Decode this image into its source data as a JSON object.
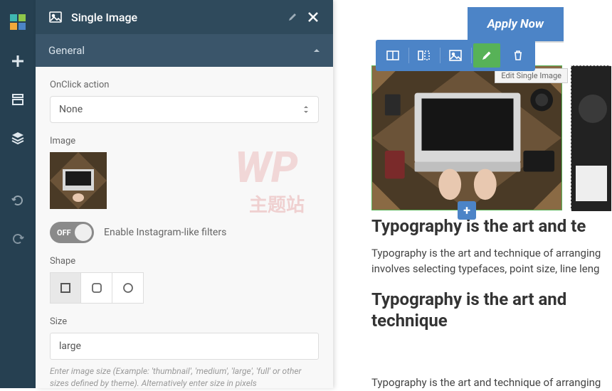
{
  "panel": {
    "title": "Single Image",
    "section": "General",
    "onclick_label": "OnClick action",
    "onclick_value": "None",
    "image_label": "Image",
    "filters_toggle_off": "OFF",
    "filters_label": "Enable Instagram-like filters",
    "shape_label": "Shape",
    "size_label": "Size",
    "size_value": "large",
    "size_help": "Enter image size (Example: 'thumbnail', 'medium', 'large', 'full' or other sizes defined by theme). Alternatively enter size in pixels"
  },
  "toolbar": {
    "tooltip": "Edit Single Image"
  },
  "content": {
    "apply": "Apply Now",
    "heading1": "Typography is the art and te",
    "para1a": "Typography is the art and technique of arranging",
    "para1b": "involves selecting typefaces, point size, line leng",
    "heading2": "Typography is the art and technique",
    "para2": "Typography is the art and technique of arranging"
  },
  "watermark": {
    "top": "WP",
    "sub": "主题站"
  }
}
